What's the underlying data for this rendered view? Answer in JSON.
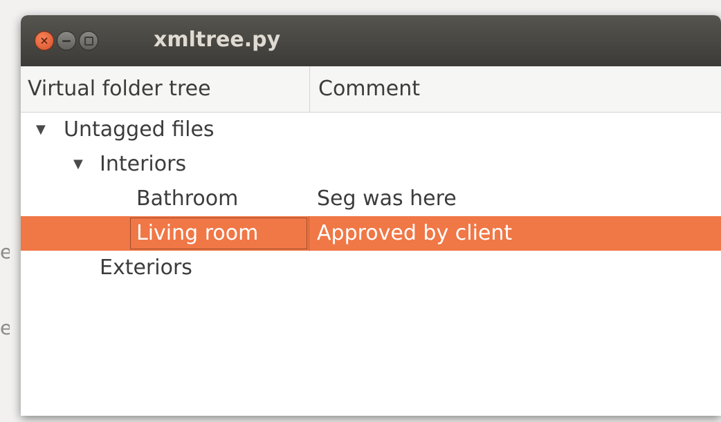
{
  "background_fragments": [
    "e",
    "e"
  ],
  "window": {
    "title": "xmltree.py",
    "buttons": {
      "close_icon": "close-icon",
      "minimize_icon": "minimize-icon",
      "maximize_icon": "maximize-icon"
    }
  },
  "columns": {
    "tree": "Virtual folder tree",
    "comment": "Comment"
  },
  "rows": [
    {
      "label": "Untagged files",
      "comment": "",
      "expanded": true,
      "selected": false
    },
    {
      "label": "Interiors",
      "comment": "",
      "expanded": true,
      "selected": false
    },
    {
      "label": "Bathroom",
      "comment": "Seg was here",
      "selected": false
    },
    {
      "label": "Living room",
      "comment": "Approved by client",
      "selected": true
    },
    {
      "label": "Exteriors",
      "comment": "",
      "selected": false
    }
  ],
  "expander_glyph": "▼",
  "colors": {
    "selection": "#f07746",
    "titlebar": "#3c3b37",
    "close_button": "#e9663d"
  }
}
